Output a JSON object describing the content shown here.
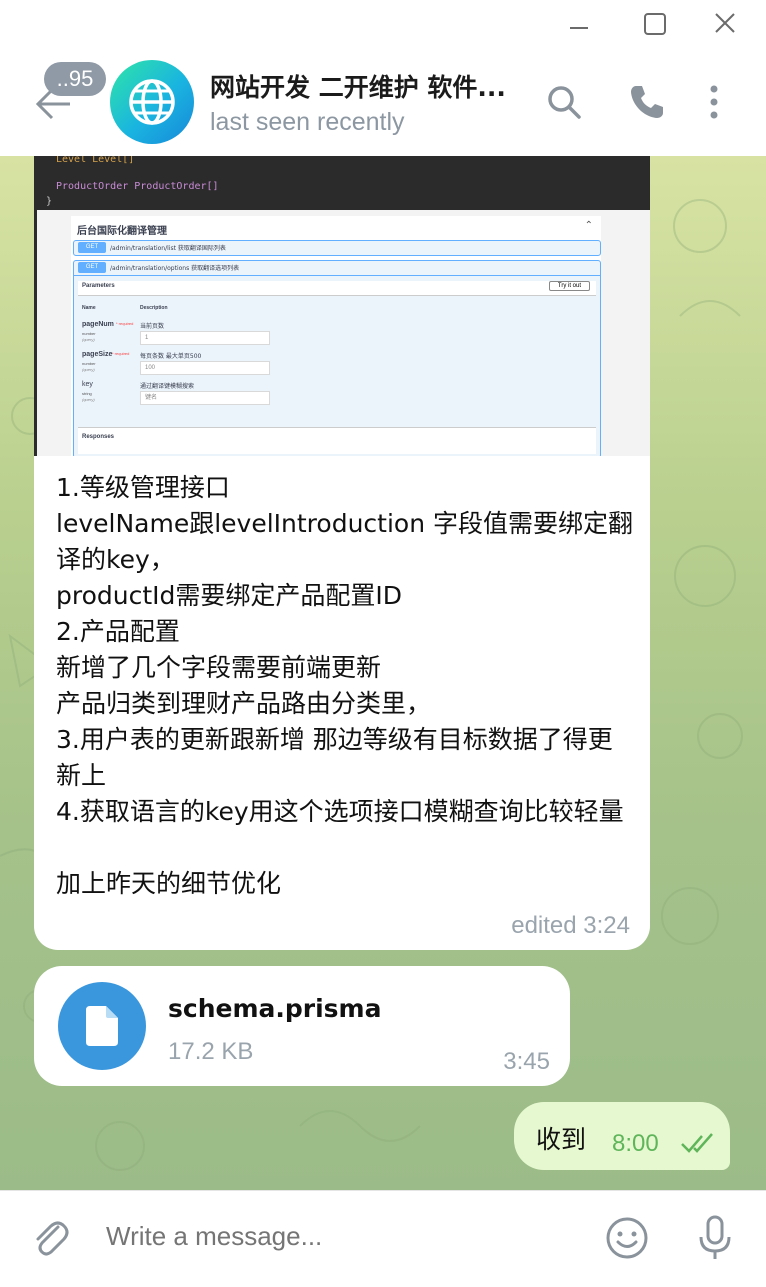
{
  "window": {
    "controls": [
      "minimize-icon",
      "maximize-icon",
      "close-icon"
    ]
  },
  "header": {
    "unread_count": "..95",
    "title": "网站开发 二开维护 软件...",
    "status": "last seen recently",
    "icons": [
      "back-arrow-icon",
      "search-icon",
      "phone-icon",
      "more-vertical-icon"
    ]
  },
  "messages": {
    "code_lines": [
      "Level Level[]",
      "ProductOrder ProductOrder[]",
      "}"
    ],
    "screenshot": {
      "title": "后台国际化翻译管理",
      "rows": [
        {
          "method": "GET",
          "path": "/admin/translation/list 获取翻译国际列表"
        },
        {
          "method": "GET",
          "path": "/admin/translation/options 获取翻译选项列表"
        }
      ],
      "tab_parameters": "Parameters",
      "try_button": "Try it out",
      "col_name": "Name",
      "col_description": "Description",
      "params": [
        {
          "name": "pageNum",
          "required": "* required",
          "type": "number",
          "loc": "(query)",
          "desc": "当前页数",
          "value": "1"
        },
        {
          "name": "pageSize",
          "required": "* required",
          "type": "number",
          "loc": "(query)",
          "desc": "每页条数 最大单页500",
          "value": "100"
        },
        {
          "name": "key",
          "required": "",
          "type": "string",
          "loc": "(query)",
          "desc": "通过翻译键模糊搜索",
          "value": "键名"
        }
      ],
      "responses_label": "Responses"
    },
    "text": "1.等级管理接口\nlevelName跟levelIntroduction 字段值需要绑定翻译的key，\nproductId需要绑定产品配置ID\n2.产品配置\n新增了几个字段需要前端更新\n产品归类到理财产品路由分类里，\n3.用户表的更新跟新增 那边等级有目标数据了得更新上\n4.获取语言的key用这个选项接口模糊查询比较轻量\n\n加上昨天的细节优化",
    "text_meta": "edited 3:24",
    "file": {
      "name": "schema.prisma",
      "size": "17.2 KB",
      "time": "3:45"
    },
    "outgoing": {
      "text": "收到",
      "time": "8:00",
      "status_icon": "double-check-icon"
    }
  },
  "composer": {
    "placeholder": "Write a message...",
    "icons": [
      "attach-icon",
      "emoji-icon",
      "microphone-icon"
    ]
  },
  "colors": {
    "accent": "#3a97dd",
    "outgoing_bubble": "#e6f8cf",
    "read_check": "#5fb55a"
  }
}
